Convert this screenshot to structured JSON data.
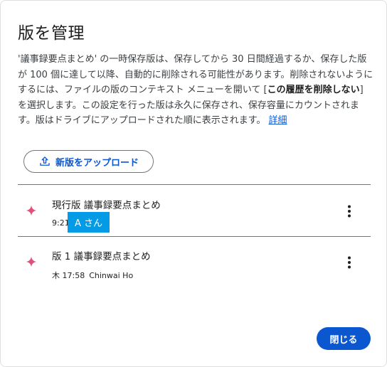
{
  "dialog": {
    "title": "版を管理",
    "description_part1": "'議事録要点まとめ' の一時保存版は、保存してから 30 日間経過するか、保存した版が 100 個に達して以降、自動的に削除される可能性があります。削除されないようにするには、ファイルの版のコンテキスト メニューを開いて [",
    "description_bold": "この履歴を削除しない",
    "description_part2": "] を選択します。この設定を行った版は永久に保存され、保存容量にカウントされます。版はドライブにアップロードされた順に表示されます。",
    "details_link": "詳細",
    "upload_label": "新版をアップロード",
    "close_label": "閉じる"
  },
  "versions": [
    {
      "name": "現行版  議事録要点まとめ",
      "time": "9:21",
      "author": "",
      "badge": "A さん"
    },
    {
      "name": "版 1  議事録要点まとめ",
      "time": "木 17:58",
      "author": "Chinwai Ho",
      "badge": ""
    }
  ],
  "colors": {
    "accent": "#0b57d0",
    "sparkle": "#e0507a",
    "badge": "#039be5"
  }
}
